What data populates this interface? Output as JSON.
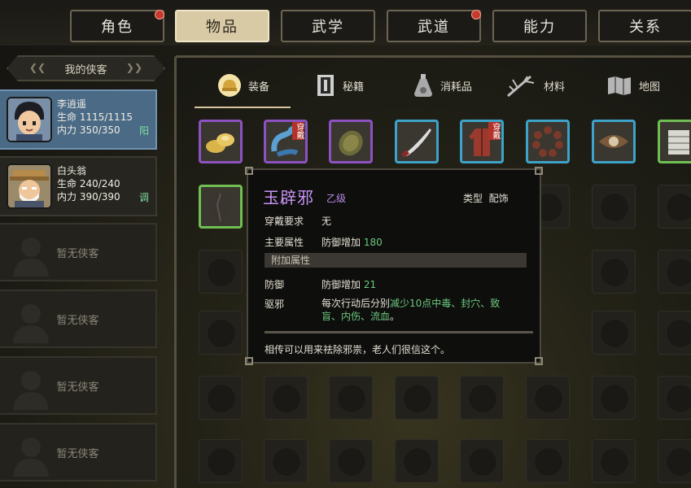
{
  "tabs": [
    {
      "label": "角色",
      "active": false,
      "notify": true
    },
    {
      "label": "物品",
      "active": true,
      "notify": false
    },
    {
      "label": "武学",
      "active": false,
      "notify": false
    },
    {
      "label": "武道",
      "active": false,
      "notify": true
    },
    {
      "label": "能力",
      "active": false,
      "notify": false
    },
    {
      "label": "关系",
      "active": false,
      "notify": false
    }
  ],
  "party": {
    "header": "我的侠客",
    "members": [
      {
        "name": "李逍遥",
        "hp_label": "生命",
        "hp": "1115/1115",
        "mp_label": "内力",
        "mp": "350/350",
        "tag": "阳",
        "selected": true
      },
      {
        "name": "白头翁",
        "hp_label": "生命",
        "hp": "240/240",
        "mp_label": "内力",
        "mp": "390/390",
        "tag": "调",
        "selected": false
      }
    ],
    "empty_label": "暂无侠客"
  },
  "categories": [
    {
      "label": "装备",
      "icon": "helmet-icon",
      "active": true
    },
    {
      "label": "秘籍",
      "icon": "book-icon",
      "active": false
    },
    {
      "label": "消耗品",
      "icon": "potion-icon",
      "active": false
    },
    {
      "label": "材料",
      "icon": "herb-icon",
      "active": false
    },
    {
      "label": "地图",
      "icon": "map-icon",
      "active": false
    }
  ],
  "items_row1": [
    {
      "icon": "gold-ingots-icon",
      "rarity": "purple",
      "worn": false
    },
    {
      "icon": "blue-sash-icon",
      "rarity": "purple",
      "worn": true
    },
    {
      "icon": "talisman-icon",
      "rarity": "purple",
      "worn": false
    },
    {
      "icon": "saber-icon",
      "rarity": "blue",
      "worn": false
    },
    {
      "icon": "red-robe-icon",
      "rarity": "blue",
      "worn": true
    },
    {
      "icon": "prayer-beads-icon",
      "rarity": "blue",
      "worn": false
    },
    {
      "icon": "eye-amulet-icon",
      "rarity": "blue",
      "worn": false
    },
    {
      "icon": "bandage-icon",
      "rarity": "green",
      "worn": false
    }
  ],
  "items_row2": [
    {
      "icon": "dark-robe-icon",
      "rarity": "green",
      "worn": false
    }
  ],
  "worn_label": "穿戴",
  "tooltip": {
    "name": "玉辟邪",
    "grade": "乙级",
    "type_label": "类型",
    "type_value": "配饰",
    "req_label": "穿戴要求",
    "req_value": "无",
    "main_label": "主要属性",
    "main_value": "防御增加",
    "main_number": "180",
    "extra_header": "附加属性",
    "def_label": "防御",
    "def_value": "防御增加",
    "def_number": "21",
    "ward_label": "驱邪",
    "ward_text_1": "每次行动后分别",
    "ward_text_2": "减少10点中毒、封穴、致",
    "ward_text_3": "盲、内伤、流血",
    "ward_text_4": "。",
    "flavor": "相传可以用来祛除邪祟，老人们很信这个。"
  }
}
